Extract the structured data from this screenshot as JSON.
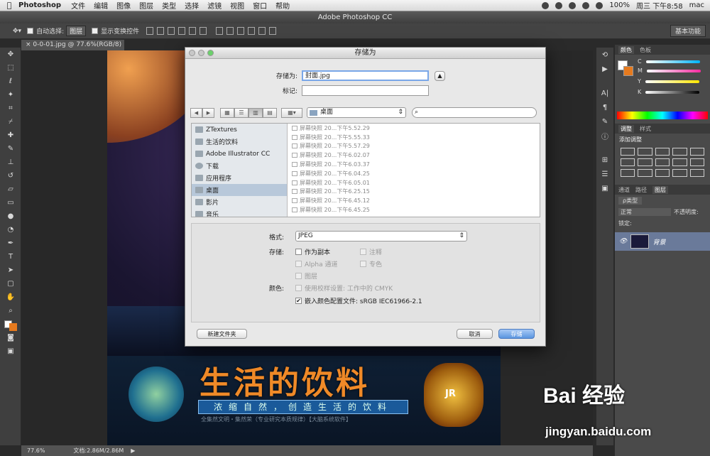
{
  "menubar": {
    "apple": "",
    "app_name": "Photoshop",
    "items": [
      "文件",
      "编辑",
      "图像",
      "图层",
      "类型",
      "选择",
      "滤镜",
      "视图",
      "窗口",
      "帮助"
    ],
    "battery": "100%",
    "clock": "周三 下午8:58",
    "user": "mac"
  },
  "window": {
    "title": "Adobe Photoshop CC"
  },
  "options_bar": {
    "auto_select_label": "自动选择:",
    "auto_select_value": "图层",
    "show_transform_label": "显示变换控件",
    "workspace": "基本功能"
  },
  "document": {
    "tab_label": "0-0-01.jpg @ 77.6%(RGB/8)",
    "zoom": "77.6%",
    "doc_size": "文档:2.86M/2.86M"
  },
  "artwork": {
    "title": "生活的饮料",
    "slogan": "浓缩自然，创造生活的饮料",
    "subline": "全集然文明・集然荣（专业研究本质规律）【大脑系统软件】",
    "crest_text": "JR"
  },
  "color_panel": {
    "tabs": [
      "颜色",
      "色板"
    ],
    "channels": [
      {
        "label": "C",
        "color": "#00b4ff"
      },
      {
        "label": "M",
        "color": "#ff2aa0"
      },
      {
        "label": "Y",
        "color": "#ffe600"
      },
      {
        "label": "K",
        "color": "#888888"
      }
    ]
  },
  "adjustments_panel": {
    "tabs": [
      "调整",
      "样式"
    ],
    "heading": "添加调整"
  },
  "layers_panel": {
    "tabs": [
      "通道",
      "路径",
      "图层"
    ],
    "filter": "ρ类型",
    "blend_mode": "正常",
    "opacity_label": "不透明度:",
    "lock_label": "锁定:",
    "layer_name": "背景"
  },
  "save_dialog": {
    "title": "存储为",
    "save_as_label": "存储为:",
    "filename": "封面.jpg",
    "tags_label": "标记:",
    "tags_value": "",
    "location": "桌面",
    "search_placeholder": "",
    "sidebar": [
      {
        "label": "ZTextures",
        "icon": "folder-icon",
        "selected": false
      },
      {
        "label": "生活的饮料",
        "icon": "folder-icon",
        "selected": false
      },
      {
        "label": "Adobe Illustrator CC",
        "icon": "folder-icon",
        "selected": false
      },
      {
        "label": "下载",
        "icon": "download-icon",
        "selected": false
      },
      {
        "label": "应用程序",
        "icon": "applications-icon",
        "selected": false
      },
      {
        "label": "桌面",
        "icon": "desktop-icon",
        "selected": true
      },
      {
        "label": "影片",
        "icon": "movies-icon",
        "selected": false
      },
      {
        "label": "音乐",
        "icon": "music-icon",
        "selected": false
      }
    ],
    "files": [
      "屏幕快照 20...下午5.52.29",
      "屏幕快照 20...下午5.55.33",
      "屏幕快照 20...下午5.57.29",
      "屏幕快照 20...下午6.02.07",
      "屏幕快照 20...下午6.03.37",
      "屏幕快照 20...下午6.04.25",
      "屏幕快照 20...下午6.05.01",
      "屏幕快照 20...下午6.25.15",
      "屏幕快照 20...下午6.45.12",
      "屏幕快照 20...下午6.45.25"
    ],
    "format_label": "格式:",
    "format_value": "JPEG",
    "save_label": "存储:",
    "opt_copy": "作为副本",
    "opt_notes": "注释",
    "opt_alpha": "Alpha 通道",
    "opt_spot": "专色",
    "opt_layers": "图层",
    "color_label": "颜色:",
    "opt_proof": "使用校样设置: 工作中的 CMYK",
    "opt_icc": "嵌入颜色配置文件: sRGB IEC61966-2.1",
    "new_folder": "新建文件夹",
    "cancel": "取消",
    "save": "存储"
  },
  "watermark": {
    "brand": "Bai 经验",
    "url": "jingyan.baidu.com"
  }
}
